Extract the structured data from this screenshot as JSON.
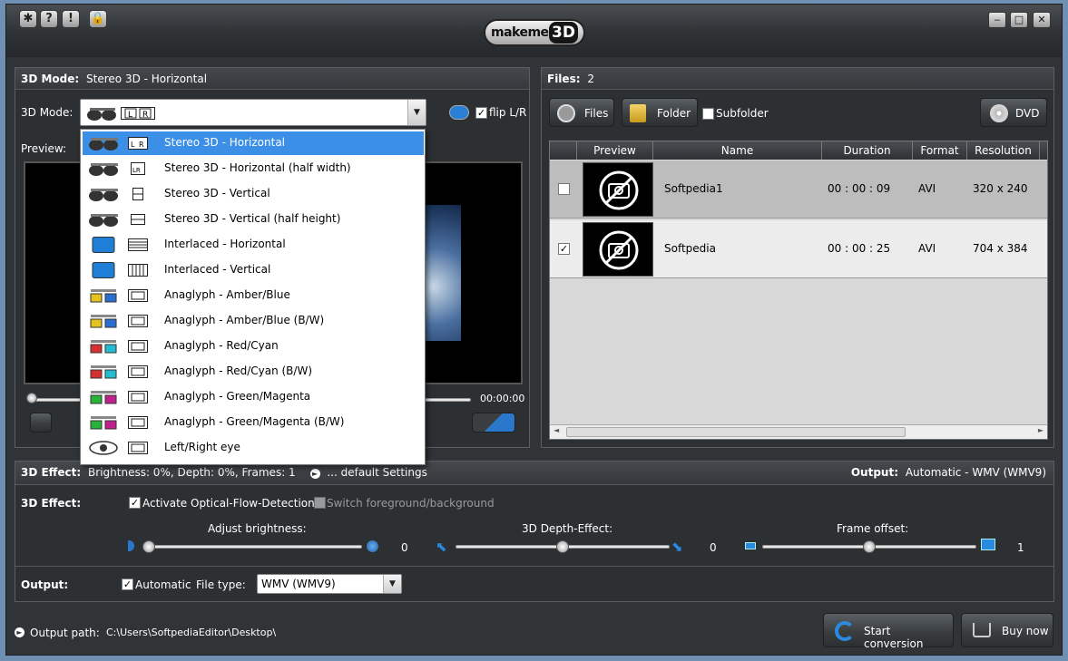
{
  "title_icons": [
    "gear-icon",
    "help-icon",
    "info-icon",
    "lock-icon"
  ],
  "logo": {
    "make": "makeme",
    "three_d": "3D"
  },
  "window_buttons": {
    "minimize": "‒",
    "maximize": "□",
    "close": "✕"
  },
  "mode_panel": {
    "header_label": "3D Mode:",
    "header_value": "Stereo 3D - Horizontal",
    "mode_label": "3D Mode:",
    "flip_label": "flip L/R",
    "flip_checked": true,
    "preview_label": "Preview:",
    "time": "00:00:00",
    "dropdown_items": [
      {
        "label": "Stereo 3D - Horizontal",
        "icon": "glasses-icon",
        "format": "lr-frame-icon",
        "selected": true
      },
      {
        "label": "Stereo 3D - Horizontal (half width)",
        "icon": "glasses-icon",
        "format": "lr-half-icon"
      },
      {
        "label": "Stereo 3D - Vertical",
        "icon": "glasses-icon",
        "format": "lr-vertical-icon"
      },
      {
        "label": "Stereo 3D - Vertical (half height)",
        "icon": "glasses-icon",
        "format": "lr-vertical-half-icon"
      },
      {
        "label": "Interlaced - Horizontal",
        "icon": "monitor-icon",
        "format": "interlaced-h-icon"
      },
      {
        "label": "Interlaced - Vertical",
        "icon": "monitor-icon",
        "format": "interlaced-v-icon"
      },
      {
        "label": "Anaglyph - Amber/Blue",
        "icon": "anaglyph-amber-icon",
        "format": "film-icon"
      },
      {
        "label": "Anaglyph - Amber/Blue (B/W)",
        "icon": "anaglyph-amber-icon",
        "format": "film-icon"
      },
      {
        "label": "Anaglyph - Red/Cyan",
        "icon": "anaglyph-red-icon",
        "format": "film-icon"
      },
      {
        "label": "Anaglyph - Red/Cyan (B/W)",
        "icon": "anaglyph-red-icon",
        "format": "film-icon"
      },
      {
        "label": "Anaglyph - Green/Magenta",
        "icon": "anaglyph-green-icon",
        "format": "film-icon"
      },
      {
        "label": "Anaglyph - Green/Magenta (B/W)",
        "icon": "anaglyph-green-icon",
        "format": "film-icon"
      },
      {
        "label": "Left/Right eye",
        "icon": "eye-icon",
        "format": "film-icon"
      }
    ]
  },
  "files_panel": {
    "header_label": "Files:",
    "count": "2",
    "files_button": "Files",
    "folder_button": "Folder",
    "subfolder_label": "Subfolder",
    "dvd_button": "DVD",
    "columns": [
      "Preview",
      "Name",
      "Duration",
      "Format",
      "Resolution"
    ],
    "rows": [
      {
        "checked": false,
        "name": "Softpedia1",
        "duration": "00 : 00 : 09",
        "format": "AVI",
        "resolution": "320 x 240"
      },
      {
        "checked": true,
        "name": "Softpedia",
        "duration": "00 : 00 : 25",
        "format": "AVI",
        "resolution": "704 x 384"
      }
    ]
  },
  "effect_bar": {
    "label": "3D Effect:",
    "summary": "Brightness: 0%, Depth: 0%, Frames: 1",
    "settings_link": "... default Settings",
    "output_label": "Output:",
    "output_value": "Automatic - WMV (WMV9)"
  },
  "effect": {
    "label": "3D Effect:",
    "optical_flow_label": "Activate Optical-Flow-Detection",
    "optical_flow_checked": true,
    "switch_label": "Switch foreground/background",
    "switch_checked": false,
    "brightness": {
      "label": "Adjust brightness:",
      "value": "0",
      "level": 0
    },
    "depth": {
      "label": "3D Depth-Effect:",
      "value": "0",
      "level": 0.5
    },
    "frame": {
      "label": "Frame offset:",
      "value": "1",
      "level": 0.5
    }
  },
  "output": {
    "label": "Output:",
    "automatic_label": "Automatic",
    "automatic_checked": true,
    "filetype_label": "File type:",
    "filetype_value": "WMV (WMV9)"
  },
  "footer": {
    "path_label": "Output path:",
    "path_value": "C:\\Users\\SoftpediaEditor\\Desktop\\",
    "start_button": "Start conversion",
    "buy_button": "Buy now"
  }
}
